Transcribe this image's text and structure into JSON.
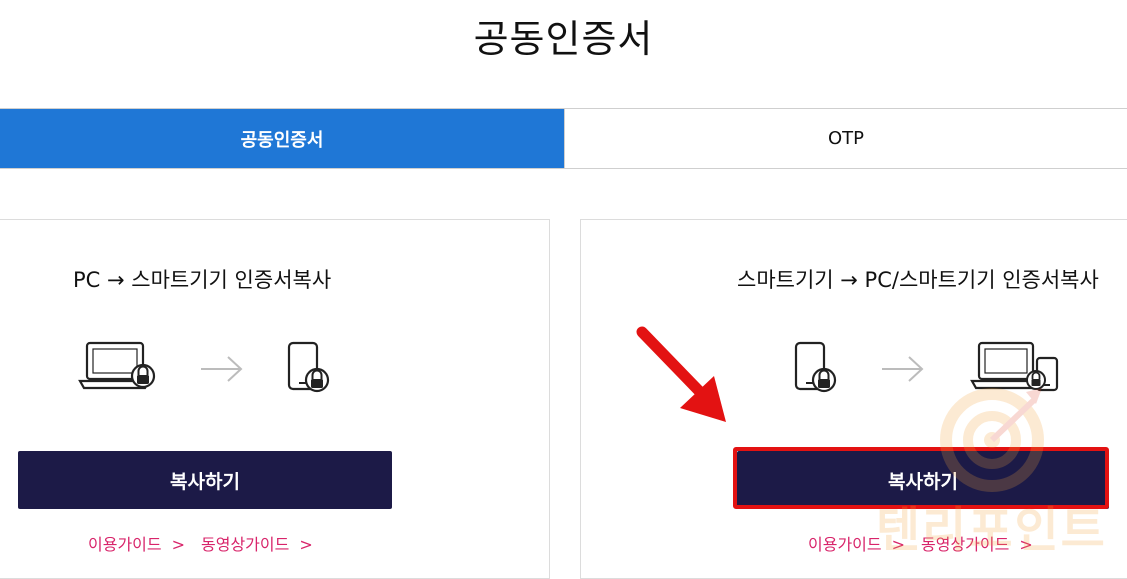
{
  "page": {
    "title": "공동인증서"
  },
  "tabs": [
    {
      "label": "공동인증서",
      "active": true
    },
    {
      "label": "OTP",
      "active": false
    }
  ],
  "cards": [
    {
      "heading": "PC → 스마트기기 인증서복사",
      "from_icon": "laptop-lock-icon",
      "to_icon": "phone-lock-icon",
      "button_label": "복사하기",
      "guide_label": "이용가이드",
      "video_guide_label": "동영상가이드",
      "chevron": ">"
    },
    {
      "heading": "스마트기기 → PC/스마트기기 인증서복사",
      "from_icon": "phone-lock-icon",
      "to_icon": "laptop-phone-icon",
      "button_label": "복사하기",
      "guide_label": "이용가이드",
      "video_guide_label": "동영상가이드",
      "chevron": ">",
      "highlighted": true
    }
  ],
  "overlay": {
    "watermark_text": "텐리포인트",
    "arrow_color": "#e31212",
    "highlight_color": "#e31212"
  },
  "colors": {
    "tab_active": "#1f77d6",
    "button": "#1c1a47",
    "guide_link": "#d8246a"
  }
}
